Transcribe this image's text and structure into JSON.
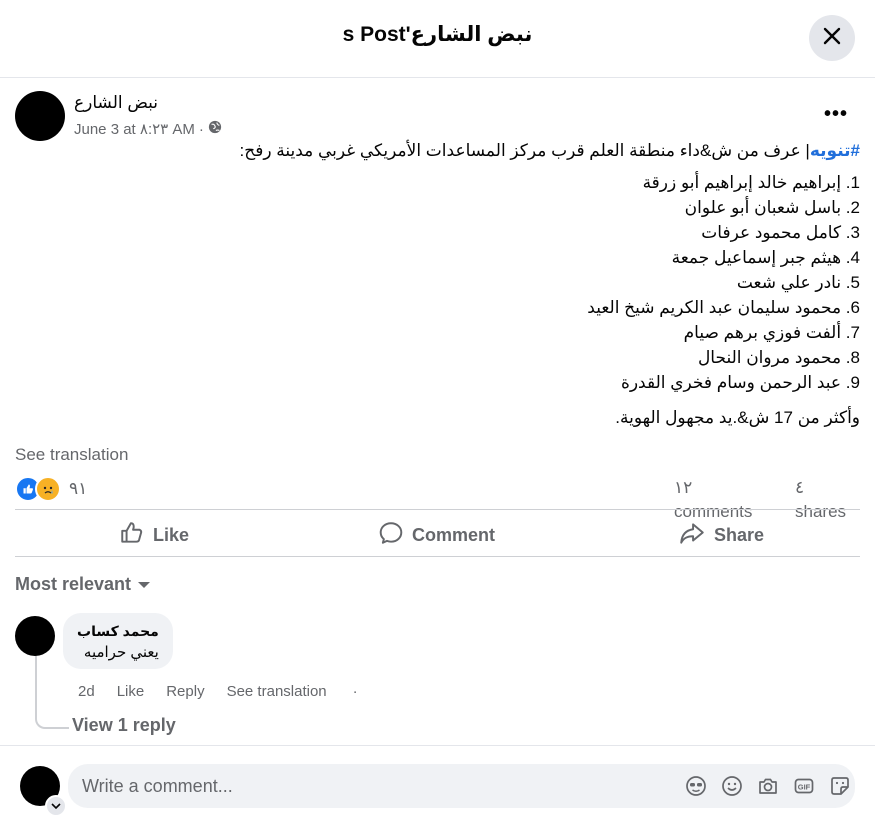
{
  "header": {
    "title": "s Post'نبض الشارع"
  },
  "post": {
    "author": "نبض الشارع",
    "timestamp": "June 3 at ٨:٢٣ AM",
    "separator": "·",
    "hashtag": "#تنويه",
    "intro": "| عرف من ش&داء منطقة العلم قرب مركز المساعدات الأمريكي غربي مدينة رفح:",
    "names": [
      "1. إبراهيم خالد إبراهيم أبو زرقة",
      "2. باسل شعبان أبو علوان",
      "3. كامل محمود عرفات",
      "4. هيثم جبر إسماعيل جمعة",
      "5. نادر علي شعت",
      "6. محمود سليمان عبد الكريم شيخ العيد",
      "7. ألفت فوزي برهم صيام",
      "8. محمود مروان النحال",
      "9. عبد الرحمن وسام فخري القدرة"
    ],
    "closing": "وأكثر من 17 ش&.يد مجهول الهوية.",
    "see_translation": "See translation",
    "reaction_count": "٩١",
    "comments_num": "١٢",
    "comments_label": "comments",
    "shares_num": "٤",
    "shares_label": "shares"
  },
  "actions": {
    "like": "Like",
    "comment": "Comment",
    "share": "Share"
  },
  "comments_section": {
    "sort_label": "Most relevant",
    "comments": [
      {
        "author": "محمد كساب",
        "text": "يعني حراميه",
        "time": "2d",
        "like": "Like",
        "reply": "Reply",
        "see_translation": "See translation",
        "dot": "·"
      }
    ],
    "view_replies": "View 1 reply"
  },
  "composer": {
    "placeholder": "Write a comment..."
  },
  "icons": {
    "close": "close-icon",
    "globe": "globe-icon",
    "more": "more-icon",
    "like": "thumbs-up-icon",
    "comment": "comment-icon",
    "share": "share-icon",
    "sticker_avatar": "avatar-sticker-icon",
    "emoji": "emoji-icon",
    "camera": "camera-icon",
    "gif": "gif-icon",
    "sticker": "sticker-icon"
  },
  "colors": {
    "hashtag": "#216fdb",
    "like_reaction": "#1877f2",
    "sad_reaction": "#f7b125",
    "muted": "#65676b"
  }
}
